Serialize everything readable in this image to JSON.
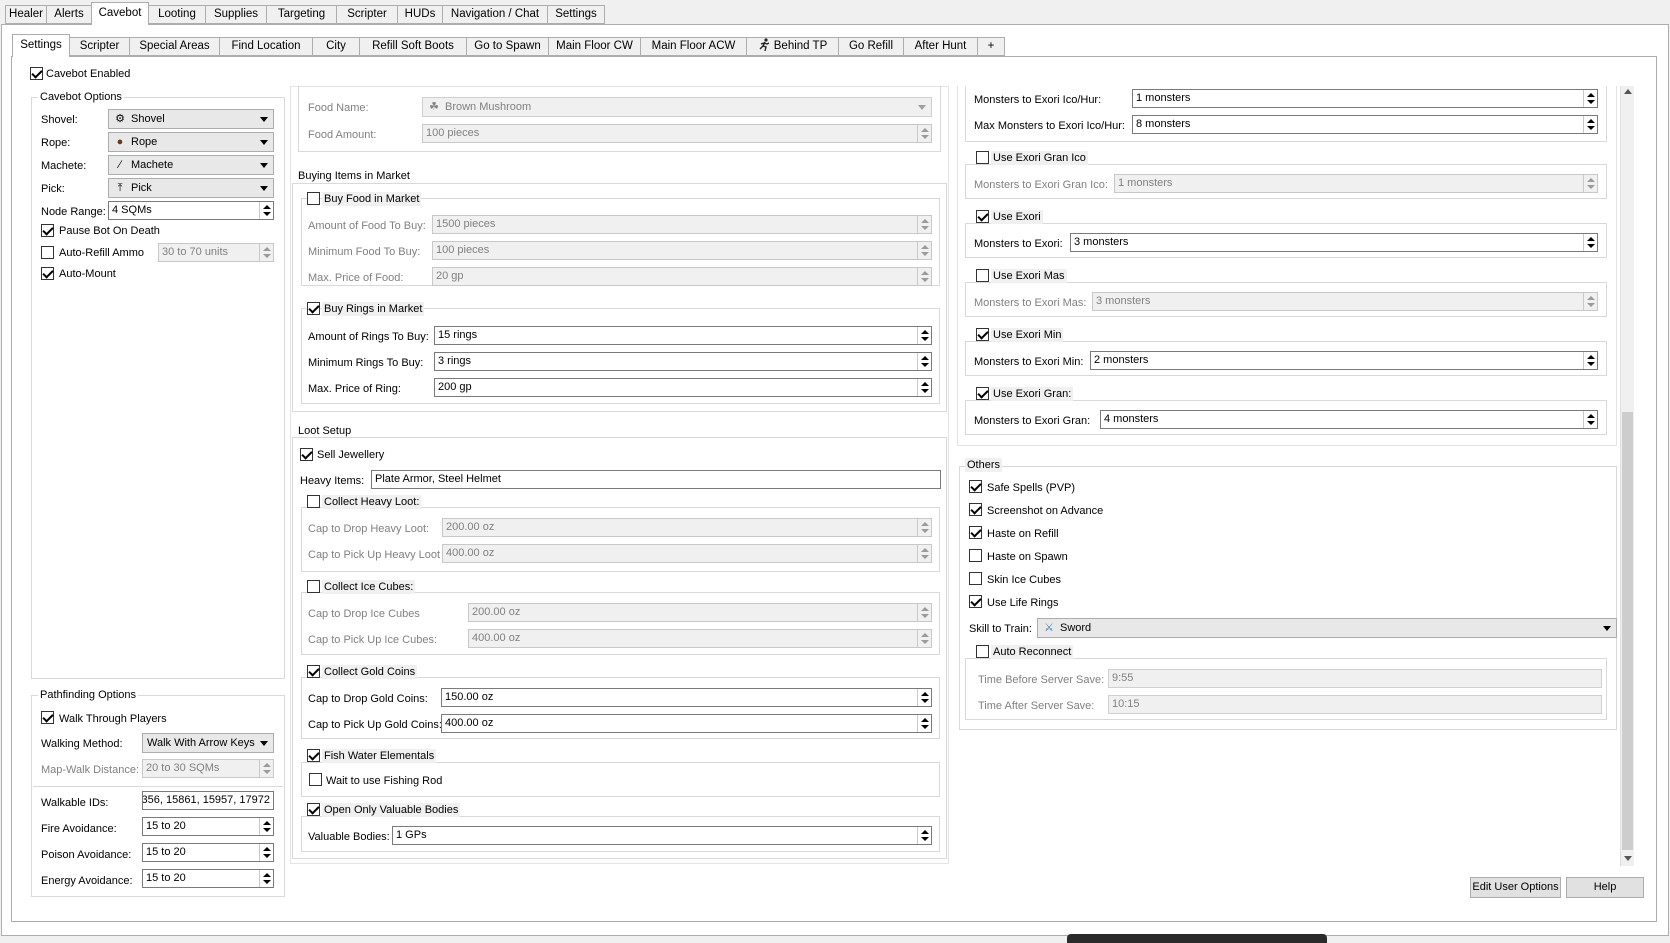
{
  "main_tabs": [
    "Healer",
    "Alerts",
    "Cavebot",
    "Looting",
    "Supplies",
    "Targeting",
    "Scripter",
    "HUDs",
    "Navigation / Chat",
    "Settings"
  ],
  "sub_tabs": [
    "Settings",
    "Scripter",
    "Special Areas",
    "Find Location",
    "City",
    "Refill Soft Boots",
    "Go to Spawn",
    "Main Floor CW",
    "Main Floor ACW",
    "Behind TP",
    "Go Refill",
    "After Hunt",
    "+"
  ],
  "cavebot_enabled": "Cavebot Enabled",
  "cavebot_options": {
    "title": "Cavebot Options",
    "shovel_label": "Shovel:",
    "shovel_value": "Shovel",
    "rope_label": "Rope:",
    "rope_value": "Rope",
    "machete_label": "Machete:",
    "machete_value": "Machete",
    "pick_label": "Pick:",
    "pick_value": "Pick",
    "node_range_label": "Node Range:",
    "node_range_value": "4 SQMs",
    "pause_bot": "Pause Bot On Death",
    "auto_refill": "Auto-Refill Ammo",
    "auto_refill_value": "30 to 70 units",
    "auto_mount": "Auto-Mount"
  },
  "pathfinding": {
    "title": "Pathfinding Options",
    "walk_through": "Walk Through Players",
    "walking_method_label": "Walking Method:",
    "walking_method_value": "Walk With Arrow Keys",
    "map_walk_label": "Map-Walk Distance:",
    "map_walk_value": "20 to 30 SQMs",
    "walkable_label": "Walkable IDs:",
    "walkable_value": "356, 15861, 15957, 17972",
    "fire_label": "Fire Avoidance:",
    "fire_value": "15 to 20",
    "poison_label": "Poison Avoidance:",
    "poison_value": "15 to 20",
    "energy_label": "Energy Avoidance:",
    "energy_value": "15 to 20"
  },
  "food": {
    "name_label": "Food Name:",
    "name_value": "Brown Mushroom",
    "amount_label": "Food Amount:",
    "amount_value": "100 pieces"
  },
  "buying": {
    "title": "Buying Items in Market",
    "buy_food": "Buy Food in Market",
    "amount_food_label": "Amount of Food To Buy:",
    "amount_food_value": "1500 pieces",
    "min_food_label": "Minimum Food To Buy:",
    "min_food_value": "100 pieces",
    "max_price_food_label": "Max. Price of Food:",
    "max_price_food_value": "20 gp",
    "buy_rings": "Buy Rings in Market",
    "amount_rings_label": "Amount of Rings To Buy:",
    "amount_rings_value": "15 rings",
    "min_rings_label": "Minimum Rings To Buy:",
    "min_rings_value": "3 rings",
    "max_price_ring_label": "Max. Price of Ring:",
    "max_price_ring_value": "200 gp"
  },
  "loot": {
    "title": "Loot Setup",
    "sell_jewellery": "Sell Jewellery",
    "heavy_items_label": "Heavy Items:",
    "heavy_items_value": "Plate Armor, Steel Helmet",
    "collect_heavy": "Collect Heavy Loot:",
    "cap_drop_heavy_label": "Cap to Drop Heavy Loot:",
    "cap_drop_heavy_value": "200.00 oz",
    "cap_pick_heavy_label": "Cap to Pick Up Heavy Loot",
    "cap_pick_heavy_value": "400.00 oz",
    "collect_ice": "Collect Ice Cubes:",
    "cap_drop_ice_label": "Cap to Drop Ice Cubes",
    "cap_drop_ice_value": "200.00 oz",
    "cap_pick_ice_label": "Cap to Pick Up Ice Cubes:",
    "cap_pick_ice_value": "400.00 oz",
    "collect_gold": "Collect Gold Coins",
    "cap_drop_gold_label": "Cap to Drop Gold Coins:",
    "cap_drop_gold_value": "150.00 oz",
    "cap_pick_gold_label": "Cap to Pick Up Gold Coins:",
    "cap_pick_gold_value": "400.00 oz",
    "fish_water": "Fish Water Elementals",
    "wait_fishing": "Wait to use Fishing Rod",
    "open_valuable": "Open Only Valuable Bodies",
    "valuable_label": "Valuable Bodies:",
    "valuable_value": "1 GPs"
  },
  "spells": {
    "exori_ico_label": "Monsters to Exori Ico/Hur:",
    "exori_ico_value": "1 monsters",
    "max_exori_ico_label": "Max Monsters to Exori Ico/Hur:",
    "max_exori_ico_value": "8 monsters",
    "use_gran_ico": "Use Exori Gran Ico",
    "gran_ico_label": "Monsters to Exori Gran Ico:",
    "gran_ico_value": "1 monsters",
    "use_exori": "Use Exori",
    "exori_label": "Monsters to Exori:",
    "exori_value": "3 monsters",
    "use_mas": "Use Exori Mas",
    "mas_label": "Monsters to Exori Mas:",
    "mas_value": "3 monsters",
    "use_min": "Use Exori Min",
    "min_label": "Monsters to Exori Min:",
    "min_value": "2 monsters",
    "use_gran": "Use Exori Gran:",
    "gran_label": "Monsters to Exori Gran:",
    "gran_value": "4 monsters"
  },
  "others": {
    "title": "Others",
    "safe_spells": "Safe Spells (PVP)",
    "screenshot": "Screenshot on Advance",
    "haste_refill": "Haste on Refill",
    "haste_spawn": "Haste on Spawn",
    "skin_ice": "Skin Ice Cubes",
    "life_rings": "Use Life Rings",
    "skill_label": "Skill to Train:",
    "skill_value": "Sword",
    "auto_reconnect": "Auto Reconnect",
    "before_label": "Time Before Server Save:",
    "before_value": "9:55",
    "after_label": "Time After Server Save:",
    "after_value": "10:15"
  },
  "buttons": {
    "edit_user": "Edit User Options",
    "help": "Help"
  }
}
